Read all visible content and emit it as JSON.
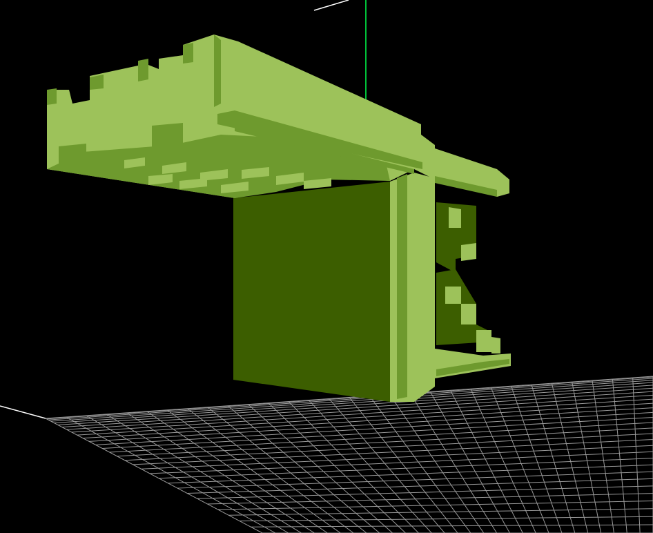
{
  "viewport": {
    "background": "#000000"
  },
  "colors": {
    "model_light": "#9DC25A",
    "model_mid": "#6E9A2E",
    "model_dark": "#3C5E00",
    "grid": "#9A9A9A",
    "axis_x": "#FFFFFF",
    "axis_y": "#00FF4C"
  },
  "scene": {
    "object": "voxel-model",
    "grid_plane": "floor-grid"
  }
}
